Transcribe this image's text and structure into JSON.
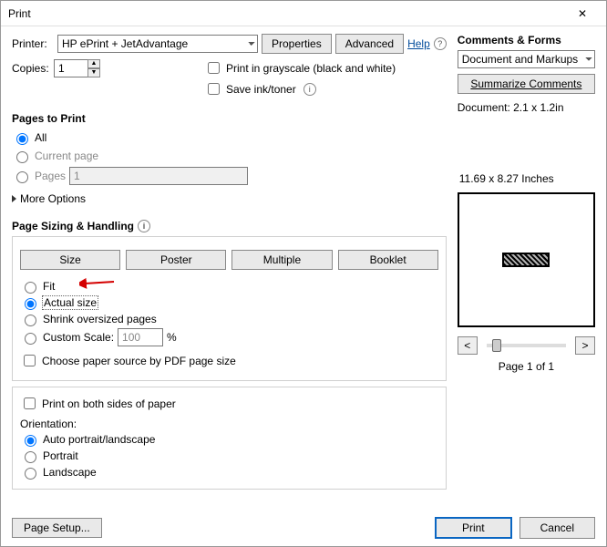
{
  "window": {
    "title": "Print"
  },
  "help": {
    "label": "Help"
  },
  "printer": {
    "label": "Printer:",
    "selected": "HP ePrint + JetAdvantage",
    "properties_btn": "Properties",
    "advanced_btn": "Advanced"
  },
  "copies": {
    "label": "Copies:",
    "value": "1"
  },
  "options": {
    "grayscale": "Print in grayscale (black and white)",
    "save_ink": "Save ink/toner"
  },
  "pages_to_print": {
    "title": "Pages to Print",
    "all": "All",
    "current": "Current page",
    "pages_label": "Pages",
    "pages_value": "1",
    "more_options": "More Options"
  },
  "sizing": {
    "title": "Page Sizing & Handling",
    "size_btn": "Size",
    "poster_btn": "Poster",
    "multiple_btn": "Multiple",
    "booklet_btn": "Booklet",
    "fit": "Fit",
    "actual": "Actual size",
    "shrink": "Shrink oversized pages",
    "custom": "Custom Scale:",
    "custom_value": "100",
    "custom_pct": "%",
    "choose_paper": "Choose paper source by PDF page size"
  },
  "duplex": {
    "both_sides": "Print on both sides of paper",
    "orientation_title": "Orientation:",
    "auto": "Auto portrait/landscape",
    "portrait": "Portrait",
    "landscape": "Landscape"
  },
  "comments_forms": {
    "title": "Comments & Forms",
    "selected": "Document and Markups",
    "summarize_btn": "Summarize Comments"
  },
  "preview": {
    "doc_dims": "Document: 2.1 x 1.2in",
    "page_dims": "11.69 x 8.27 Inches",
    "page_of": "Page 1 of 1",
    "prev_glyph": "<",
    "next_glyph": ">"
  },
  "footer": {
    "page_setup": "Page Setup...",
    "print": "Print",
    "cancel": "Cancel"
  }
}
